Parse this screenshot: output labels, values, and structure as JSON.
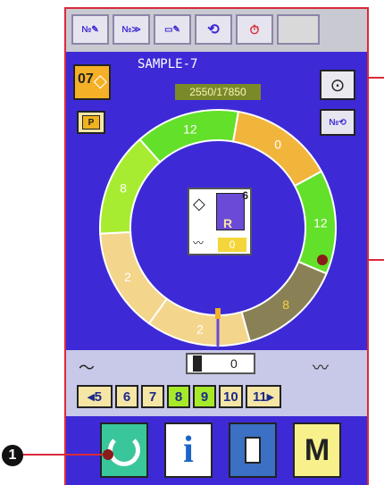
{
  "toolbar": {
    "buttons": [
      {
        "id": "tb1",
        "icon": "pattern-edit-icon"
      },
      {
        "id": "tb2",
        "icon": "pattern-forward-icon"
      },
      {
        "id": "tb3",
        "icon": "stitch-edit-icon"
      },
      {
        "id": "tb4",
        "icon": "rotate-icon"
      },
      {
        "id": "tb5",
        "icon": "timer-icon"
      },
      {
        "id": "tb6",
        "icon": "blank"
      }
    ]
  },
  "pattern": {
    "number": "07",
    "name": "SAMPLE-7",
    "length": "2550/17850",
    "p_label": "P"
  },
  "ring": {
    "segments": [
      {
        "value": "0",
        "color": "#f2b53b"
      },
      {
        "value": "12",
        "color": "#63e02a"
      },
      {
        "value": "8",
        "color": "#8a8055"
      },
      {
        "value": "2",
        "color": "#f3d58c"
      },
      {
        "value": "2",
        "color": "#f3d58c"
      },
      {
        "value": "8",
        "color": "#a8ec31"
      },
      {
        "value": "12",
        "color": "#63e02a"
      }
    ]
  },
  "center_button": {
    "count": "6",
    "letter": "R",
    "value": "0"
  },
  "counter": {
    "value": "0"
  },
  "keys": [
    "◂5",
    "6",
    "7",
    "8",
    "9",
    "10",
    "11▸"
  ],
  "bottom": {
    "mode_label": "M",
    "info_label": "i"
  },
  "callouts": {
    "number": "1"
  }
}
